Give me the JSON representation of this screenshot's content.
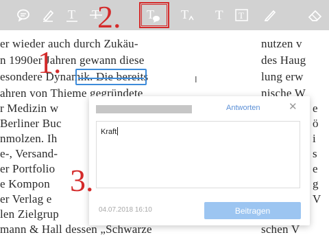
{
  "toolbar": {
    "icons": [
      {
        "name": "comment-bubble-icon"
      },
      {
        "name": "highlighter-pen-icon"
      },
      {
        "name": "underline-text-icon",
        "glyph": "T"
      },
      {
        "name": "strikethrough-text-icon",
        "glyph": "T"
      },
      {
        "name": "text-comment-icon",
        "glyph": "T"
      },
      {
        "name": "text-insert-icon",
        "glyph": "T"
      },
      {
        "name": "text-icon",
        "glyph": "T"
      },
      {
        "name": "text-box-icon",
        "glyph": "T"
      },
      {
        "name": "pencil-icon"
      },
      {
        "name": "eraser-icon"
      }
    ],
    "active_tool": "text-comment-icon",
    "accent_color": "#d42a2a"
  },
  "markers": {
    "step1": "1.",
    "step2": "2.",
    "step3": "3."
  },
  "document": {
    "left_column": [
      "er wieder auch durch Zukäu-",
      "n 1990er Jahren gewann diese",
      "esondere Dynamik. Die bereits",
      "ahren von Thieme gegründete",
      "r Medizin w",
      "Berliner Buc",
      "nmolzen. Ih",
      "e-, Versand-",
      "er Portfolio",
      "e Kompon",
      "er Verlag e",
      "len Zielgrup",
      "mann & Hall dessen „Schwarze"
    ],
    "right_column": [
      "nutzen v",
      "des Haug",
      "lung erw",
      "nische W",
      "e",
      "ö",
      "i",
      "s",
      "e",
      "g",
      "V",
      "schen V"
    ],
    "highlighted_word": "Dynamik"
  },
  "comment_popup": {
    "reply_label": "Antworten",
    "close_label": "✕",
    "text_value": "Kraft",
    "date": "04.07.2018",
    "time": "16:10",
    "submit_label": "Beitragen",
    "submit_color": "#9cc5f1"
  }
}
